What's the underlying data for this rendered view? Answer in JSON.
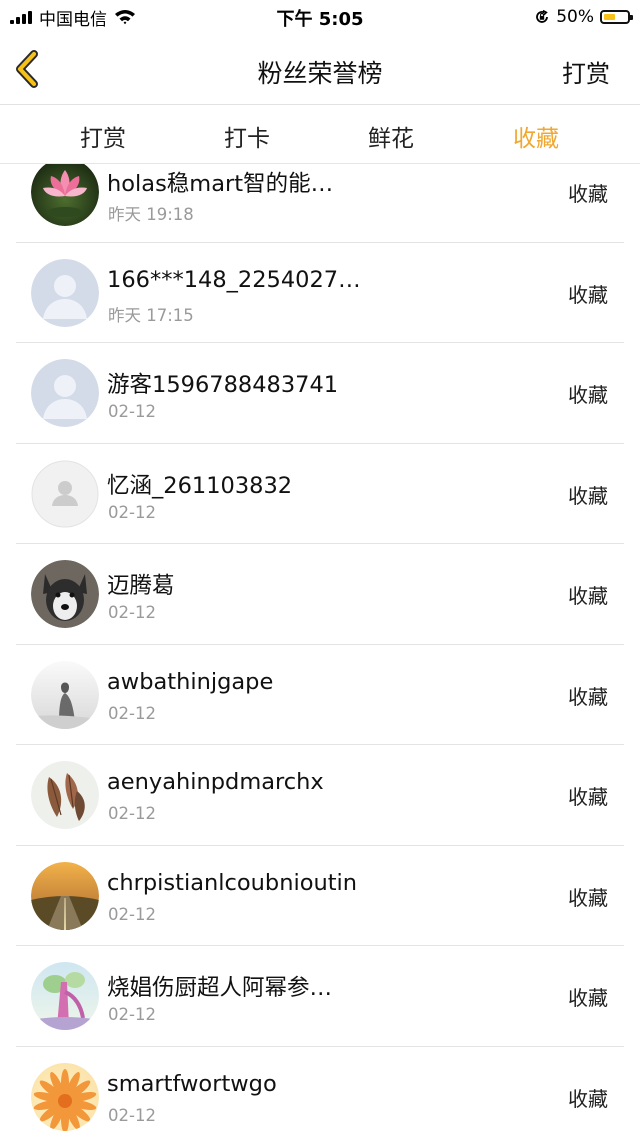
{
  "status_bar": {
    "carrier": "中国电信",
    "time": "下午 5:05",
    "battery": "50%",
    "battery_level": 0.5
  },
  "nav": {
    "title": "粉丝荣誉榜",
    "action": "打赏"
  },
  "tabs": [
    {
      "label": "打赏",
      "active": false
    },
    {
      "label": "打卡",
      "active": false
    },
    {
      "label": "鲜花",
      "active": false
    },
    {
      "label": "收藏",
      "active": true
    }
  ],
  "colors": {
    "accent": "#f0a830",
    "date": "#9a9a9a",
    "divider": "#e4e4e4"
  },
  "fans": [
    {
      "name": "holas稳mart智的能…",
      "date": "昨天 19:18",
      "action": "收藏",
      "avatar": "lotus-avatar"
    },
    {
      "name": "166***148_2254027…",
      "date": "昨天 17:15",
      "action": "收藏",
      "avatar": "default-user-avatar"
    },
    {
      "name": "游客1596788483741",
      "date": "02-12",
      "action": "收藏",
      "avatar": "default-user-avatar"
    },
    {
      "name": "忆涵_261103832",
      "date": "02-12",
      "action": "收藏",
      "avatar": "grey-user-avatar"
    },
    {
      "name": "迈腾葛",
      "date": "02-12",
      "action": "收藏",
      "avatar": "husky-dog-avatar"
    },
    {
      "name": "awbathinjgape",
      "date": "02-12",
      "action": "收藏",
      "avatar": "girl-silhouette-avatar"
    },
    {
      "name": "aenyahinpdmarchx",
      "date": "02-12",
      "action": "收藏",
      "avatar": "dry-leaves-avatar"
    },
    {
      "name": "chrpistianlcoubnioutin",
      "date": "02-12",
      "action": "收藏",
      "avatar": "sunset-road-avatar"
    },
    {
      "name": "烧娼伤厨超人阿幂参…",
      "date": "02-12",
      "action": "收藏",
      "avatar": "pink-tree-avatar"
    },
    {
      "name": "smartfwortwgo",
      "date": "02-12",
      "action": "收藏",
      "avatar": "orange-flower-avatar"
    }
  ]
}
